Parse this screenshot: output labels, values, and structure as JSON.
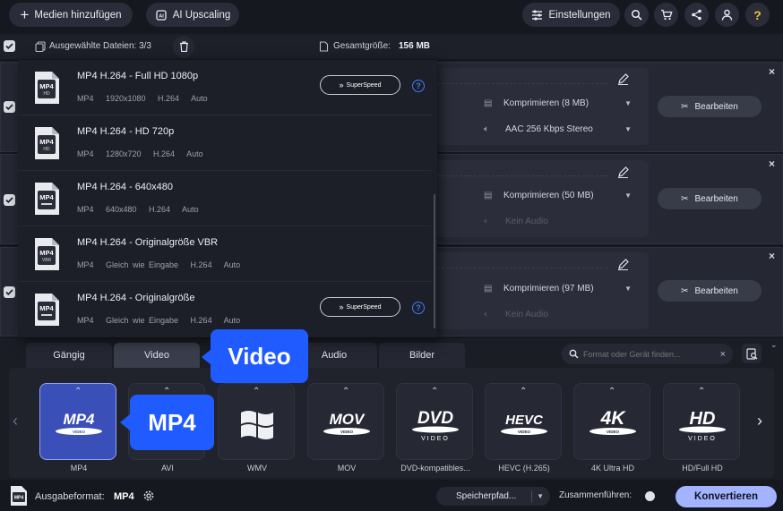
{
  "topbar": {
    "add_files": "Medien hinzufügen",
    "ai_upscaling": "AI Upscaling",
    "settings": "Einstellungen"
  },
  "selection": {
    "selected_files": "Ausgewählte Dateien: 3/3",
    "total_size_label": "Gesamtgröße:",
    "total_size": "156 MB"
  },
  "presets": [
    {
      "title": "MP4 H.264 - Full HD 1080p",
      "meta": "MP4   1920x1080   H.264   Auto",
      "badge": "HD",
      "superspeed": true
    },
    {
      "title": "MP4 H.264 - HD 720p",
      "meta": "MP4   1280x720   H.264   Auto",
      "badge": "HD",
      "superspeed": false
    },
    {
      "title": "MP4 H.264 - 640x480",
      "meta": "MP4   640x480   H.264   Auto",
      "badge": "",
      "superspeed": false
    },
    {
      "title": "MP4 H.264 - Originalgröße VBR",
      "meta": "MP4   Gleich wie Eingabe   H.264   Auto",
      "badge": "VBR",
      "superspeed": false
    },
    {
      "title": "MP4 H.264 - Originalgröße",
      "meta": "MP4   Gleich wie Eingabe   H.264   Auto",
      "badge": "",
      "superspeed": true
    }
  ],
  "superspeed_label": "SuperSpeed",
  "files": [
    {
      "compress": "Komprimieren (8 MB)",
      "audio": "AAC 256 Kbps Stereo",
      "edit": "Bearbeiten"
    },
    {
      "compress": "Komprimieren (50 MB)",
      "audio": "Kein Audio",
      "edit": "Bearbeiten"
    },
    {
      "compress": "Komprimieren (97 MB)",
      "audio": "Kein Audio",
      "edit": "Bearbeiten"
    }
  ],
  "tabs": [
    "Gängig",
    "Video",
    "Audio",
    "Bilder"
  ],
  "search": {
    "placeholder": "Format oder Gerät finden..."
  },
  "formats": [
    {
      "logo": "MP4",
      "sub": "VIDEO",
      "label": "MP4"
    },
    {
      "logo": "AVI",
      "sub": "",
      "label": "AVI"
    },
    {
      "logo": "",
      "sub": "",
      "label": "WMV"
    },
    {
      "logo": "MOV",
      "sub": "VIDEO",
      "label": "MOV"
    },
    {
      "logo": "DVD",
      "sub": "VIDEO",
      "label": "DVD-kompatibles..."
    },
    {
      "logo": "HEVC",
      "sub": "VIDEO",
      "label": "HEVC (H.265)"
    },
    {
      "logo": "4K",
      "sub": "VIDEO",
      "label": "4K Ultra HD"
    },
    {
      "logo": "HD",
      "sub": "VIDEO",
      "label": "HD/Full HD"
    }
  ],
  "tooltips": {
    "tab_tip": "Video",
    "format_tip": "MP4"
  },
  "bottom": {
    "output_label": "Ausgabeformat:",
    "output_value": "MP4",
    "save_path": "Speicherpfad...",
    "merge": "Zusammenführen:",
    "convert": "Konvertieren"
  },
  "colors": {
    "accent": "#1f5bff",
    "convert": "#a3b3ff",
    "help": "#3d7cff",
    "selected_tile": "#3a4fb8"
  }
}
